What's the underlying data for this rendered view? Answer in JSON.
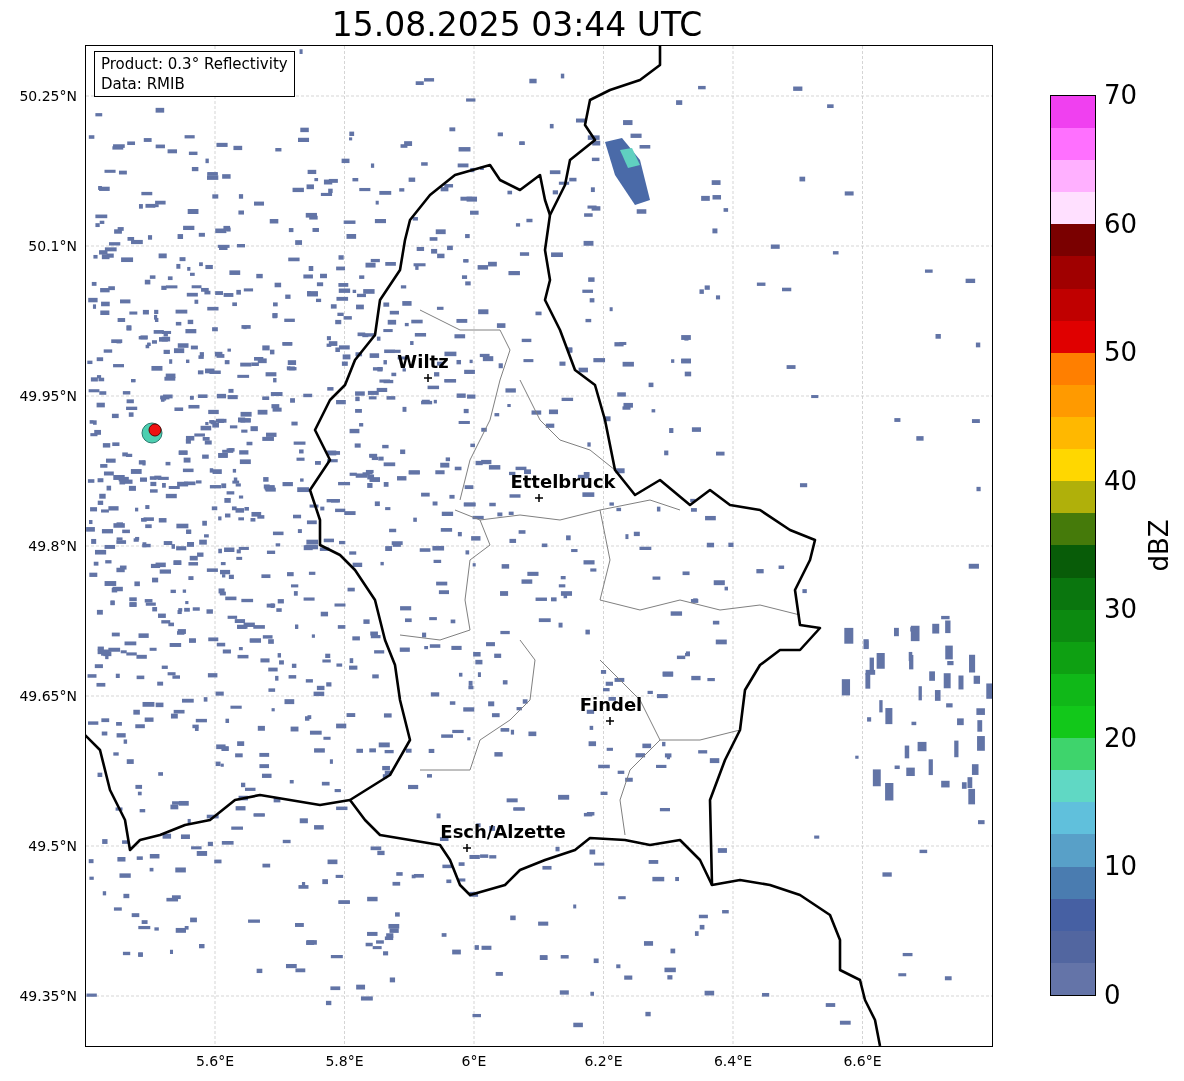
{
  "title": "15.08.2025 03:44 UTC",
  "info_box": [
    "Product: 0.3° Reflectivity",
    "Data: RMIB"
  ],
  "lat_ticks": [
    "50.25°N",
    "50.1°N",
    "49.95°N",
    "49.8°N",
    "49.65°N",
    "49.5°N",
    "49.35°N"
  ],
  "lon_ticks": [
    "5.6°E",
    "5.8°E",
    "6°E",
    "6.2°E",
    "6.4°E",
    "6.6°E"
  ],
  "cities": [
    {
      "name": "Wiltz"
    },
    {
      "name": "Ettelbruck"
    },
    {
      "name": "Findel"
    },
    {
      "name": "Esch/Alzette"
    }
  ],
  "colorbar": {
    "label": "dBZ",
    "ticks": [
      "70",
      "60",
      "50",
      "40",
      "30",
      "20",
      "10",
      "0"
    ],
    "segments": [
      {
        "color": "#6474a8"
      },
      {
        "color": "#5266a0"
      },
      {
        "color": "#4660a3"
      },
      {
        "color": "#4a7cb0"
      },
      {
        "color": "#58a0c8"
      },
      {
        "color": "#60c0dc"
      },
      {
        "color": "#60d8c4"
      },
      {
        "color": "#3ed46c"
      },
      {
        "color": "#12c81a"
      },
      {
        "color": "#10b818"
      },
      {
        "color": "#0ea012"
      },
      {
        "color": "#0c8a10"
      },
      {
        "color": "#0a760e"
      },
      {
        "color": "#085c08"
      },
      {
        "color": "#457a0a"
      },
      {
        "color": "#b0b00a"
      },
      {
        "color": "#ffd700"
      },
      {
        "color": "#ffb800"
      },
      {
        "color": "#ff9a00"
      },
      {
        "color": "#ff7f00"
      },
      {
        "color": "#e00000"
      },
      {
        "color": "#c00000"
      },
      {
        "color": "#a00000"
      },
      {
        "color": "#7a0000"
      },
      {
        "color": "#ffe0ff"
      },
      {
        "color": "#ffb0ff"
      },
      {
        "color": "#ff70ff"
      },
      {
        "color": "#f040f0"
      }
    ]
  }
}
